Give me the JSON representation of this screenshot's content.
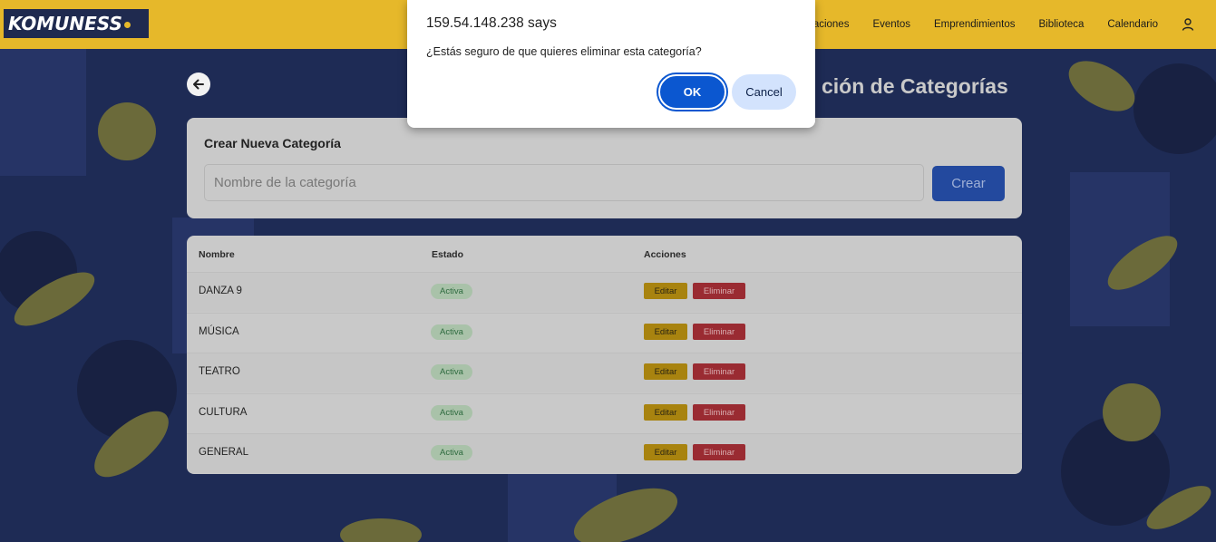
{
  "header": {
    "logo": "KOMUNESS",
    "nav": [
      "aciones",
      "Eventos",
      "Emprendimientos",
      "Biblioteca",
      "Calendario"
    ],
    "user_icon": "user-icon"
  },
  "main": {
    "title": "ción de Categorías",
    "create": {
      "title": "Crear Nueva Categoría",
      "placeholder": "Nombre de la categoría",
      "button": "Crear"
    },
    "table": {
      "headers": [
        "Nombre",
        "Estado",
        "Acciones"
      ],
      "rows": [
        {
          "name": "DANZA 9",
          "status": "Activa",
          "edit": "Editar",
          "delete": "Eliminar"
        },
        {
          "name": "MÚSICA",
          "status": "Activa",
          "edit": "Editar",
          "delete": "Eliminar"
        },
        {
          "name": "TEATRO",
          "status": "Activa",
          "edit": "Editar",
          "delete": "Eliminar"
        },
        {
          "name": "CULTURA",
          "status": "Activa",
          "edit": "Editar",
          "delete": "Eliminar"
        },
        {
          "name": "GENERAL",
          "status": "Activa",
          "edit": "Editar",
          "delete": "Eliminar"
        }
      ]
    }
  },
  "dialog": {
    "title": "159.54.148.238 says",
    "message": "¿Estás seguro de que quieres eliminar esta categoría?",
    "ok": "OK",
    "cancel": "Cancel"
  },
  "colors": {
    "header_bg": "#e6b82a",
    "primary_blue": "#0b57d0",
    "edit": "#a8830f",
    "delete": "#9a2b32"
  }
}
